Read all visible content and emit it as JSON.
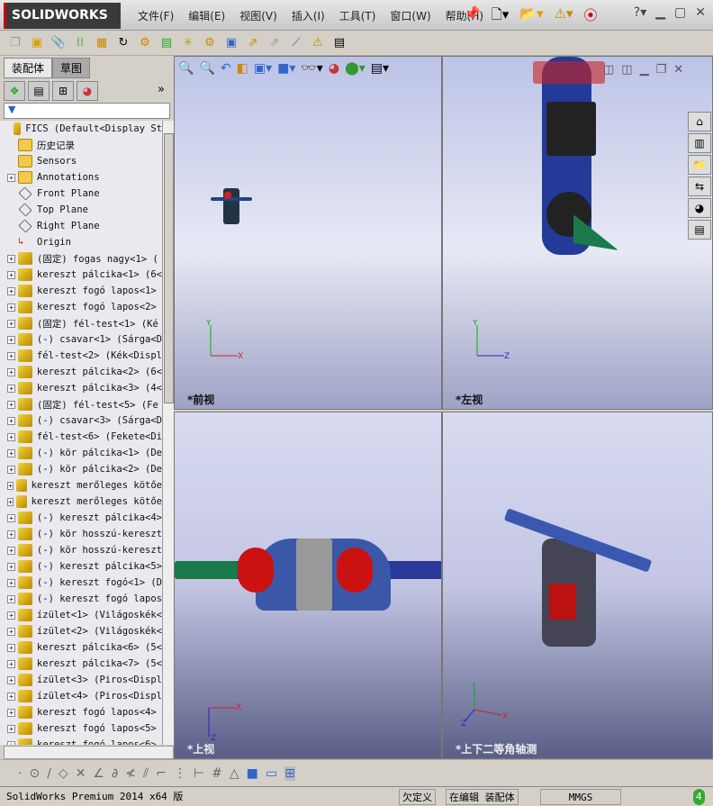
{
  "app": {
    "logo": "SOLIDWORKS",
    "menu": [
      "文件(F)",
      "编辑(E)",
      "视图(V)",
      "插入(I)",
      "工具(T)",
      "窗口(W)",
      "帮助(H)"
    ]
  },
  "sidebar": {
    "tabs": [
      "装配体",
      "草图"
    ],
    "expand": "»",
    "tree": [
      {
        "label": "FICS  (Default<Display St",
        "icon": "assembly",
        "exp": false
      },
      {
        "label": "历史记录",
        "icon": "history",
        "exp": false
      },
      {
        "label": "Sensors",
        "icon": "sensor",
        "exp": false
      },
      {
        "label": "Annotations",
        "icon": "annotation",
        "exp": true
      },
      {
        "label": "Front Plane",
        "icon": "plane",
        "exp": false
      },
      {
        "label": "Top Plane",
        "icon": "plane",
        "exp": false
      },
      {
        "label": "Right Plane",
        "icon": "plane",
        "exp": false
      },
      {
        "label": "Origin",
        "icon": "origin",
        "exp": false
      },
      {
        "label": "(固定) fogas nagy<1> (",
        "icon": "part",
        "exp": true
      },
      {
        "label": "kereszt pálcika<1> (6<",
        "icon": "part",
        "exp": true
      },
      {
        "label": "kereszt fogó lapos<1>",
        "icon": "part",
        "exp": true
      },
      {
        "label": "kereszt fogó lapos<2>",
        "icon": "part",
        "exp": true
      },
      {
        "label": "(固定) fél-test<1> (Ké",
        "icon": "part",
        "exp": true
      },
      {
        "label": "(-) csavar<1> (Sárga<D",
        "icon": "part",
        "exp": true
      },
      {
        "label": "fél-test<2> (Kék<Displ",
        "icon": "part",
        "exp": true
      },
      {
        "label": "kereszt pálcika<2> (6<",
        "icon": "part",
        "exp": true
      },
      {
        "label": "kereszt pálcika<3> (4<",
        "icon": "part",
        "exp": true
      },
      {
        "label": "(固定) fél-test<5> (Fe",
        "icon": "part",
        "exp": true
      },
      {
        "label": "(-) csavar<3> (Sárga<D",
        "icon": "part",
        "exp": true
      },
      {
        "label": "fél-test<6> (Fekete<Di",
        "icon": "part",
        "exp": true
      },
      {
        "label": "(-) kör pálcika<1> (De",
        "icon": "part",
        "exp": true
      },
      {
        "label": "(-) kör pálcika<2> (De",
        "icon": "part",
        "exp": true
      },
      {
        "label": "kereszt merőleges kötőe",
        "icon": "part",
        "exp": true
      },
      {
        "label": "kereszt merőleges kötőe",
        "icon": "part",
        "exp": true
      },
      {
        "label": "(-) kereszt pálcika<4>",
        "icon": "part",
        "exp": true
      },
      {
        "label": "(-) kör hosszú-kereszt",
        "icon": "part",
        "exp": true
      },
      {
        "label": "(-) kör hosszú-kereszt",
        "icon": "part",
        "exp": true
      },
      {
        "label": "(-) kereszt pálcika<5>",
        "icon": "part",
        "exp": true
      },
      {
        "label": "(-) kereszt fogó<1> (D",
        "icon": "part",
        "exp": true
      },
      {
        "label": "(-) kereszt fogó lapos",
        "icon": "part",
        "exp": true
      },
      {
        "label": "ízület<1> (Világoskék<",
        "icon": "part",
        "exp": true
      },
      {
        "label": "ízület<2> (Világoskék<",
        "icon": "part",
        "exp": true
      },
      {
        "label": "kereszt pálcika<6> (5<",
        "icon": "part",
        "exp": true
      },
      {
        "label": "kereszt pálcika<7> (5<",
        "icon": "part",
        "exp": true
      },
      {
        "label": "ízület<3> (Piros<Displ",
        "icon": "part",
        "exp": true
      },
      {
        "label": "ízület<4> (Piros<Displ",
        "icon": "part",
        "exp": true
      },
      {
        "label": "kereszt fogó lapos<4>",
        "icon": "part",
        "exp": true
      },
      {
        "label": "kereszt fogó lapos<5>",
        "icon": "part",
        "exp": true
      },
      {
        "label": "kereszt fogó lapos<6>",
        "icon": "part",
        "exp": true
      }
    ]
  },
  "viewports": [
    {
      "label": "*前视",
      "axes": [
        "Y",
        "X"
      ]
    },
    {
      "label": "*左视",
      "axes": [
        "Y",
        "Z"
      ]
    },
    {
      "label": "*上视",
      "axes": [
        "X",
        "Z"
      ]
    },
    {
      "label": "*上下二等角轴测",
      "axes": [
        "Y",
        "X",
        "Z"
      ]
    }
  ],
  "status": {
    "product": "SolidWorks Premium 2014 x64 版",
    "state": "欠定义",
    "mode": "在编辑 装配体",
    "units": "MMGS",
    "badge": "4"
  }
}
